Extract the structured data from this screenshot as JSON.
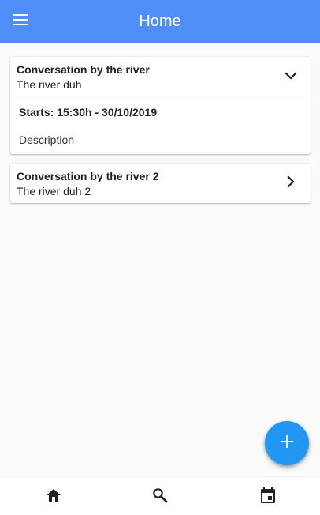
{
  "appbar": {
    "title": "Home",
    "menu_icon": "menu-icon",
    "color": "#4f8ef7"
  },
  "events": [
    {
      "title": "Conversation by the river",
      "location": "The river duh",
      "expanded": true,
      "starts": "Starts: 15:30h - 30/10/2019",
      "description": "Description",
      "chevron_icon": "chevron-down-icon"
    },
    {
      "title": "Conversation by the river 2",
      "location": "The river duh 2",
      "expanded": false,
      "chevron_icon": "chevron-right-icon"
    }
  ],
  "fab": {
    "icon": "add-icon",
    "color": "#2196f3"
  },
  "bottom_nav": {
    "items": [
      {
        "icon": "home-icon"
      },
      {
        "icon": "search-icon"
      },
      {
        "icon": "calendar-icon"
      }
    ]
  }
}
